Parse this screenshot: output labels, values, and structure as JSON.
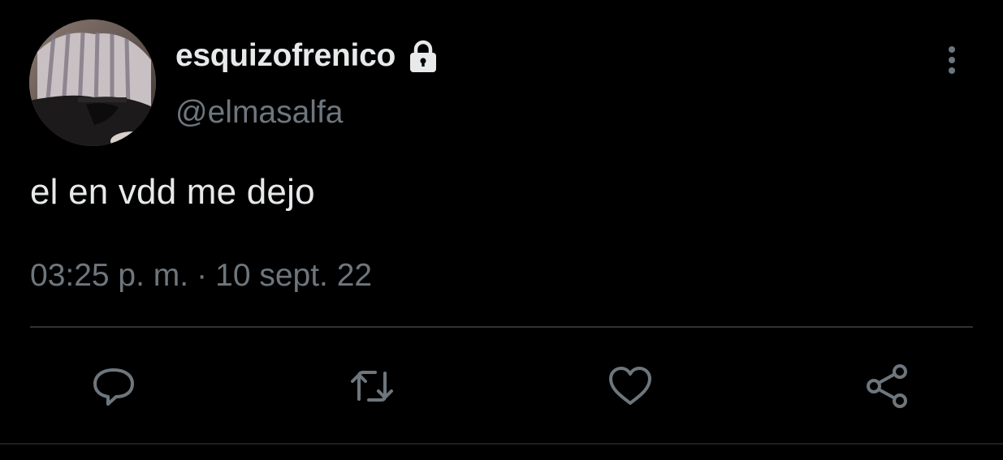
{
  "author": {
    "display_name": "esquizofrenico",
    "handle": "@elmasalfa",
    "protected": true,
    "avatar": "profile-photo",
    "badge_icon": "lock-icon"
  },
  "tweet": {
    "text": "el en vdd me dejo",
    "time": "03:25 p. m.",
    "separator": "·",
    "date": "10 sept. 22"
  },
  "actions": [
    {
      "name": "reply",
      "icon": "speech-bubble-icon"
    },
    {
      "name": "retweet",
      "icon": "retweet-icon"
    },
    {
      "name": "like",
      "icon": "heart-icon"
    },
    {
      "name": "share",
      "icon": "share-icon"
    }
  ],
  "menu": {
    "icon": "vertical-ellipsis-icon"
  },
  "colors": {
    "background": "#000000",
    "primary_text": "#e7e9ea",
    "secondary_text": "#6e767d",
    "divider": "#2f3336"
  }
}
